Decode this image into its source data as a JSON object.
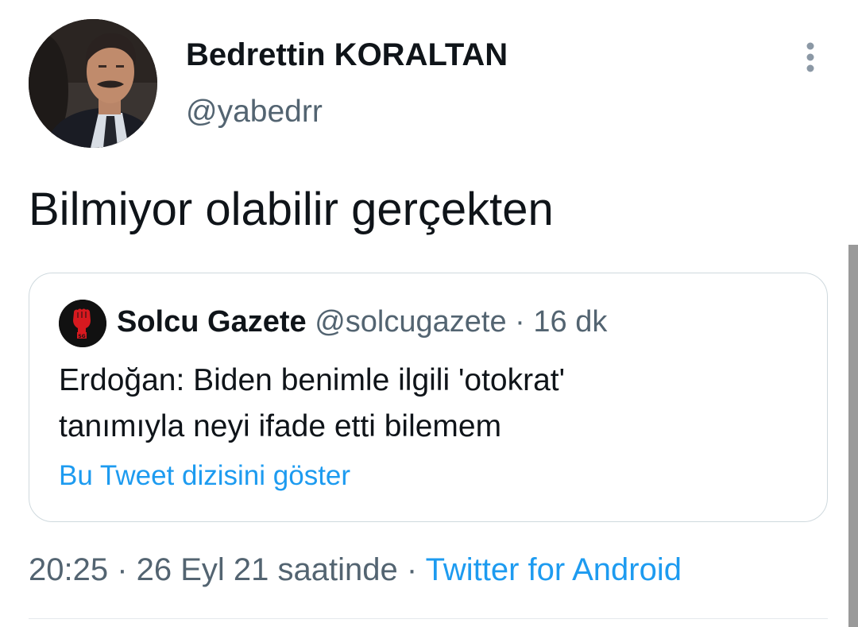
{
  "author": {
    "display_name": "Bedrettin KORALTAN",
    "handle": "@yabedrr",
    "avatar_icon": "profile-photo"
  },
  "tweet": {
    "text": "Bilmiyor olabilir gerçekten"
  },
  "menu": {
    "icon": "more-vertical-icon"
  },
  "quote": {
    "display_name": "Solcu Gazete",
    "handle": "@solcugazete",
    "separator": " · ",
    "time": "16 dk",
    "text_lines": [
      "Erdoğan: Biden benimle ilgili 'otokrat'",
      "tanımıyla neyi ifade etti bilemem"
    ],
    "show_thread_link": "Bu Tweet dizisini göster",
    "avatar_icon": "raised-fist-logo",
    "avatar_logo_text": "SG"
  },
  "meta": {
    "timestamp": "20:25 · 26 Eyl 21 saatinde",
    "separator": " · ",
    "source": "Twitter for Android"
  },
  "colors": {
    "text_primary": "#0f1419",
    "text_secondary": "#536471",
    "link": "#1d9bf0",
    "border": "#cfd9de",
    "logo_red": "#d7191f"
  }
}
